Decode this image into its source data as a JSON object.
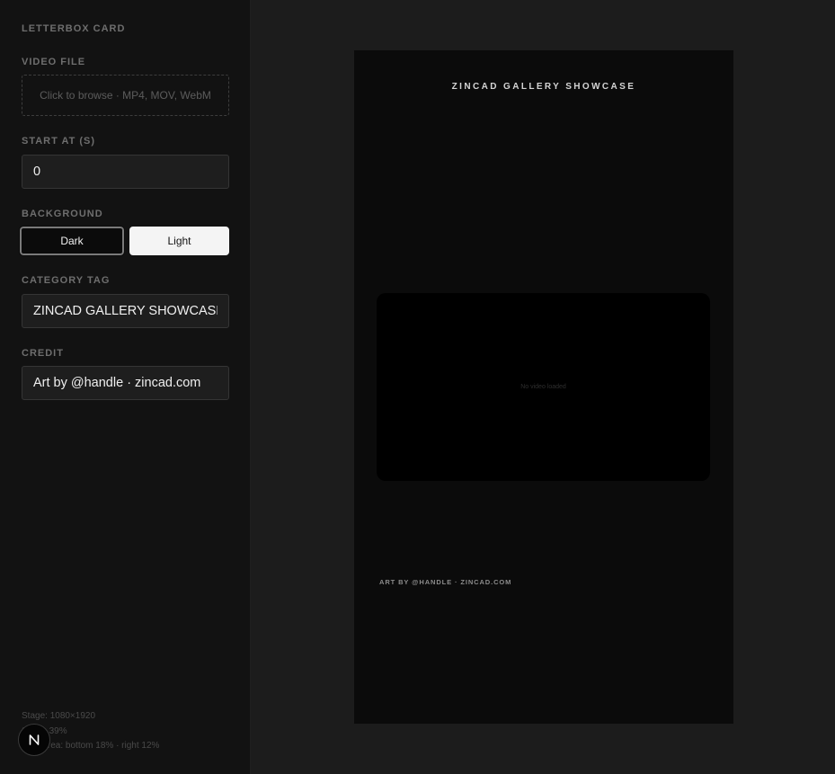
{
  "sidebar": {
    "title": "LETTERBOX CARD",
    "video_file": {
      "label": "VIDEO FILE",
      "dropzone_text": "Click to browse · MP4, MOV, WebM"
    },
    "start_at": {
      "label": "START AT (S)",
      "value": "0"
    },
    "background": {
      "label": "BACKGROUND",
      "options": [
        "Dark",
        "Light"
      ],
      "selected": "Dark"
    },
    "category_tag": {
      "label": "CATEGORY TAG",
      "value": "ZINCAD GALLERY SHOWCASE"
    },
    "credit": {
      "label": "CREDIT",
      "value": "Art by @handle · zincad.com"
    },
    "stats": {
      "stage": "Stage: 1080×1920",
      "scale": "Scale: 39%",
      "safe_area": "Safe area: bottom 18% · right 12%"
    },
    "badge_letter": "N"
  },
  "preview": {
    "category_tag": "ZINCAD GALLERY SHOWCASE",
    "video_placeholder": "No video loaded",
    "credit": "ART BY @HANDLE · ZINCAD.COM"
  },
  "colors": {
    "sidebar_bg": "#121212",
    "canvas_bg": "#1c1c1c",
    "stage_bg": "#0b0b0b",
    "video_bg": "#000000",
    "light_option_bg": "#f4f4f4"
  }
}
